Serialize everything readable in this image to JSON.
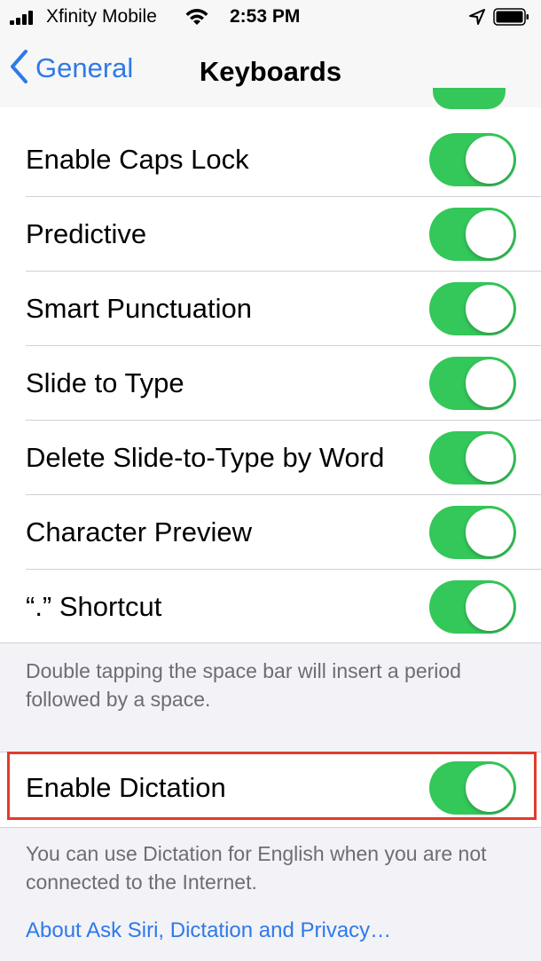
{
  "status_bar": {
    "carrier": "Xfinity Mobile",
    "time": "2:53 PM"
  },
  "nav": {
    "back_label": "General",
    "title": "Keyboards"
  },
  "toggle_rows": [
    {
      "label": "Enable Caps Lock",
      "on": true
    },
    {
      "label": "Predictive",
      "on": true
    },
    {
      "label": "Smart Punctuation",
      "on": true
    },
    {
      "label": "Slide to Type",
      "on": true
    },
    {
      "label": "Delete Slide-to-Type by Word",
      "on": true
    },
    {
      "label": "Character Preview",
      "on": true
    },
    {
      "label": "“.” Shortcut",
      "on": true
    }
  ],
  "shortcut_footer": "Double tapping the space bar will insert a period followed by a space.",
  "dictation": {
    "label": "Enable Dictation",
    "on": true,
    "footer": "You can use Dictation for English when you are not connected to the Internet.",
    "privacy_link": "About Ask Siri, Dictation and Privacy…"
  },
  "colors": {
    "toggle_on": "#34c759",
    "link": "#2e7ae8",
    "highlight": "#e23b2c"
  }
}
